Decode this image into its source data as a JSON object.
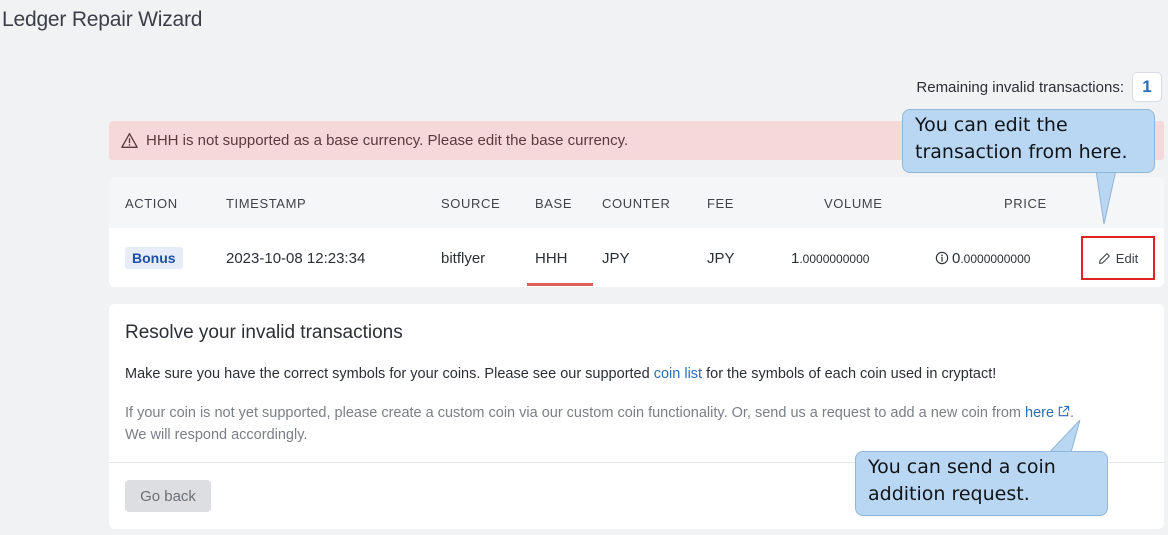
{
  "page": {
    "title": "Ledger Repair Wizard"
  },
  "remaining": {
    "label": "Remaining invalid transactions:",
    "count": "1"
  },
  "alert": {
    "message": "HHH is not supported as a base currency. Please edit the base currency."
  },
  "table": {
    "headers": {
      "action": "ACTION",
      "timestamp": "TIMESTAMP",
      "source": "SOURCE",
      "base": "BASE",
      "counter": "COUNTER",
      "fee": "FEE",
      "volume": "VOLUME",
      "price": "PRICE"
    },
    "row": {
      "action": "Bonus",
      "timestamp": "2023-10-08 12:23:34",
      "source": "bitflyer",
      "base": "HHH",
      "counter": "JPY",
      "fee": "JPY",
      "volume_int": "1",
      "volume_frac": ".0000000000",
      "price_int": "0",
      "price_frac": ".0000000000",
      "edit_label": "Edit"
    }
  },
  "resolve": {
    "title": "Resolve your invalid transactions",
    "p1_before": "Make sure you have the correct symbols for your coins. Please see our supported ",
    "p1_link": "coin list",
    "p1_after": " for the symbols of each coin used in cryptact!",
    "p2_before": "If your coin is not yet supported, please create a custom coin via our custom coin functionality. Or, send us a request to add a new coin from ",
    "p2_link": "here",
    "p2_after": ".",
    "p3": "We will respond accordingly.",
    "go_back_label": "Go back"
  },
  "callouts": {
    "edit": "You can edit the\ntransaction from here.",
    "request": "You can send a coin\naddition request."
  },
  "colors": {
    "accent_link": "#2a6fb8",
    "alert_bg": "#f7d8d8",
    "highlight_red": "#e0231f",
    "callout_bg": "#b9d7f2"
  },
  "icons": {
    "alert": "warning-triangle-icon",
    "edit": "pencil-icon",
    "price": "info-circle-icon",
    "external": "external-link-icon"
  }
}
